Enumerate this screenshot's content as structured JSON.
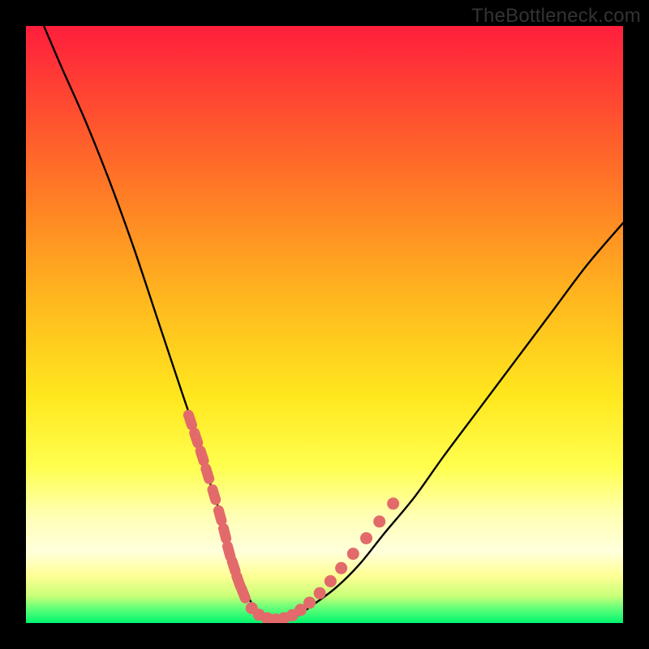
{
  "watermark": "TheBottleneck.com",
  "chart_data": {
    "type": "line",
    "title": "",
    "xlabel": "",
    "ylabel": "",
    "xlim": [
      0,
      100
    ],
    "ylim": [
      0,
      100
    ],
    "legend": false,
    "grid": false,
    "background_gradient_colors": [
      "#FF1E3C",
      "#FF7A1E",
      "#FFD21E",
      "#FFF53C",
      "#FFFFC8",
      "#FFFF96",
      "#00FF6E"
    ],
    "series": [
      {
        "name": "curve",
        "color": "#000000",
        "x": [
          3,
          6,
          10,
          14,
          18,
          22,
          26,
          28,
          30,
          32,
          33.5,
          35,
          36.5,
          38,
          40,
          42,
          45,
          48,
          52,
          56,
          60,
          65,
          70,
          76,
          82,
          88,
          94,
          100
        ],
        "y": [
          100,
          93,
          84,
          74,
          63,
          51,
          39,
          33,
          26,
          20,
          15,
          10,
          6,
          3,
          1,
          0.5,
          1,
          3,
          6,
          10,
          15,
          21,
          28,
          36,
          44,
          52,
          60,
          67
        ]
      },
      {
        "name": "left-markers",
        "color": "#E36A6A",
        "marker": "pill",
        "x": [
          27.5,
          28.5,
          29.5,
          30.4,
          31.5,
          32.5,
          33.3,
          34.0,
          34.8,
          35.6,
          36.4
        ],
        "y": [
          34.0,
          31.0,
          28.0,
          25.0,
          21.5,
          18.0,
          15.0,
          12.0,
          9.5,
          7.0,
          5.0
        ]
      },
      {
        "name": "valley-markers",
        "color": "#E36A6A",
        "marker": "dot",
        "x": [
          37.8,
          39.0,
          40.4,
          41.8,
          43.2,
          44.6
        ],
        "y": [
          2.5,
          1.4,
          0.8,
          0.6,
          0.8,
          1.3
        ]
      },
      {
        "name": "right-markers",
        "color": "#E36A6A",
        "marker": "dot",
        "x": [
          46.0,
          47.5,
          49.2,
          51.0,
          52.8,
          54.8,
          57.0,
          59.2,
          61.5
        ],
        "y": [
          2.2,
          3.4,
          5.0,
          7.0,
          9.2,
          11.6,
          14.2,
          17.0,
          20.0
        ]
      }
    ]
  }
}
